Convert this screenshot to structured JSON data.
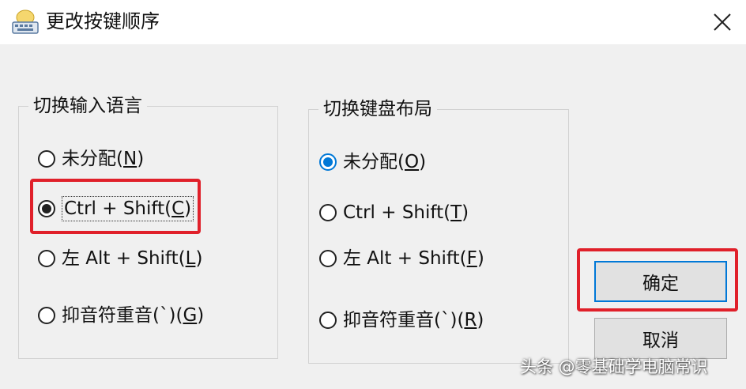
{
  "window": {
    "title": "更改按键顺序",
    "app_icon": "keyboard-settings-icon",
    "close_icon": "close-icon"
  },
  "language_group": {
    "legend": "切换输入语言",
    "options": [
      {
        "text": "未分配",
        "hotkey_open": "(",
        "hotkey_key": "N",
        "hotkey_close": ")",
        "checked": false
      },
      {
        "text": "Ctrl + Shift",
        "hotkey_open": "(",
        "hotkey_key": "C",
        "hotkey_close": ")",
        "checked": true
      },
      {
        "text": "左 Alt + Shift",
        "hotkey_open": "(",
        "hotkey_key": "L",
        "hotkey_close": ")",
        "checked": false
      },
      {
        "text": "抑音符重音(`)",
        "hotkey_open": "(",
        "hotkey_key": "G",
        "hotkey_close": ")",
        "checked": false
      }
    ]
  },
  "layout_group": {
    "legend": "切换键盘布局",
    "options": [
      {
        "text": "未分配",
        "hotkey_open": "(",
        "hotkey_key": "O",
        "hotkey_close": ")",
        "checked": true
      },
      {
        "text": "Ctrl + Shift",
        "hotkey_open": "(",
        "hotkey_key": "T",
        "hotkey_close": ")",
        "checked": false
      },
      {
        "text": "左 Alt + Shift",
        "hotkey_open": "(",
        "hotkey_key": "F",
        "hotkey_close": ")",
        "checked": false
      },
      {
        "text": "抑音符重音(`)",
        "hotkey_open": "(",
        "hotkey_key": "R",
        "hotkey_close": ")",
        "checked": false
      }
    ]
  },
  "buttons": {
    "ok": "确定",
    "cancel": "取消"
  },
  "watermark": "头条 @零基础学电脑常识",
  "colors": {
    "highlight": "#e0202a",
    "accent": "#0078d7"
  }
}
